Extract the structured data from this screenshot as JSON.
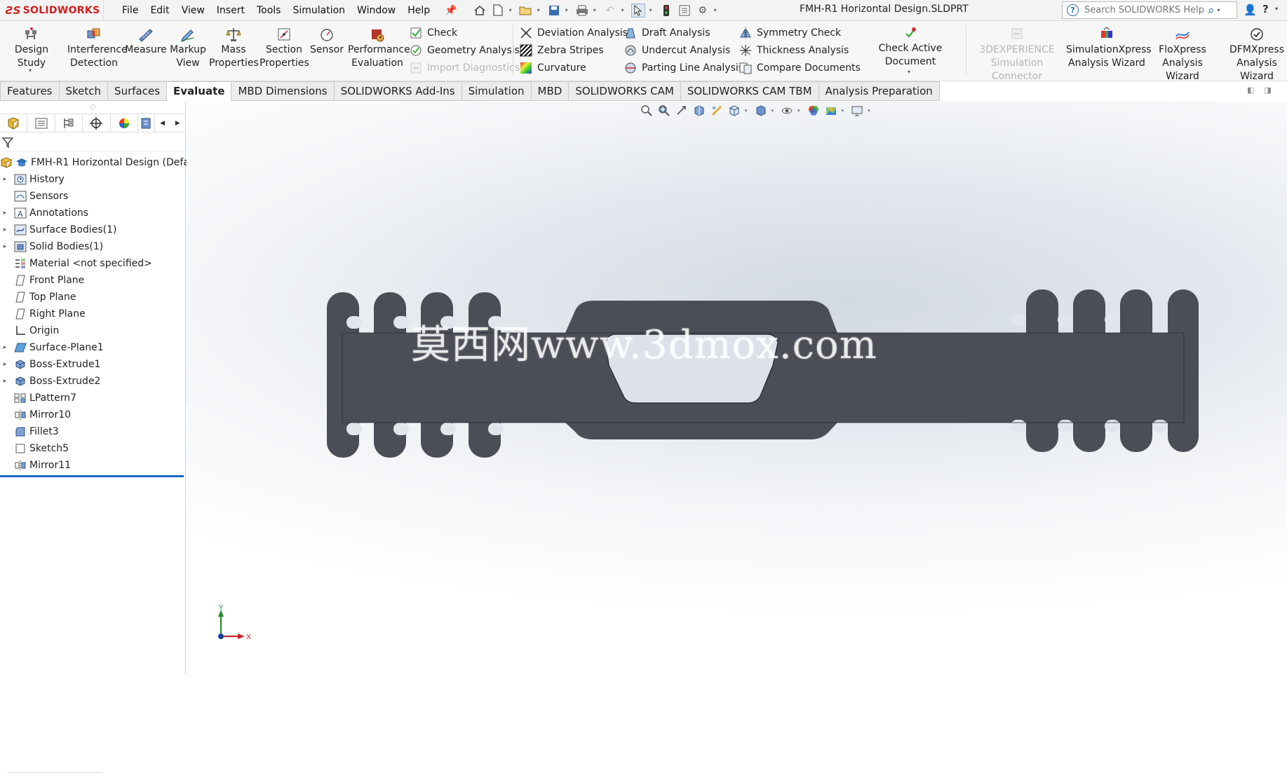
{
  "app": {
    "logo_ds": "ƧS",
    "logo_name": "SOLIDWORKS",
    "menus": [
      "File",
      "Edit",
      "View",
      "Insert",
      "Tools",
      "Simulation",
      "Window",
      "Help"
    ],
    "document_title": "FMH-R1 Horizontal Design.SLDPRT",
    "search_placeholder": "Search SOLIDWORKS Help",
    "help_glyph": "?"
  },
  "ribbon": {
    "design_study": "Design Study",
    "interference_1": "Interference",
    "interference_2": "Detection",
    "measure": "Measure",
    "markup_1": "Markup",
    "markup_2": "View",
    "mass_1": "Mass",
    "mass_2": "Properties",
    "section_1": "Section",
    "section_2": "Properties",
    "sensor": "Sensor",
    "performance_1": "Performance",
    "performance_2": "Evaluation",
    "check": "Check",
    "geometry_analysis": "Geometry Analysis",
    "import_diagnostics": "Import Diagnostics",
    "deviation_analysis": "Deviation Analysis",
    "zebra_stripes": "Zebra Stripes",
    "curvature": "Curvature",
    "draft_analysis": "Draft Analysis",
    "undercut_analysis": "Undercut Analysis",
    "parting_line_analysis": "Parting Line Analysis",
    "symmetry_check": "Symmetry Check",
    "thickness_analysis": "Thickness Analysis",
    "compare_documents": "Compare Documents",
    "check_active_document": "Check Active Document",
    "exp_connector_1": "3DEXPERIENCE",
    "exp_connector_2": "Simulation Connector",
    "simxpress_1": "SimulationXpress",
    "simxpress_2": "Analysis Wizard",
    "floxpress_1": "FloXpress",
    "floxpress_2": "Analysis Wizard",
    "dfmxpress_1": "DFMXpress",
    "dfmxpress_2": "Analysis Wizard"
  },
  "tabs": [
    {
      "label": "Features",
      "active": false
    },
    {
      "label": "Sketch",
      "active": false
    },
    {
      "label": "Surfaces",
      "active": false
    },
    {
      "label": "Evaluate",
      "active": true
    },
    {
      "label": "MBD Dimensions",
      "active": false
    },
    {
      "label": "SOLIDWORKS Add-Ins",
      "active": false
    },
    {
      "label": "Simulation",
      "active": false
    },
    {
      "label": "MBD",
      "active": false
    },
    {
      "label": "SOLIDWORKS CAM",
      "active": false
    },
    {
      "label": "SOLIDWORKS CAM TBM",
      "active": false
    },
    {
      "label": "Analysis Preparation",
      "active": false
    }
  ],
  "feature_tree": {
    "root": "FMH-R1 Horizontal Design  (Defa",
    "items": [
      {
        "label": "History",
        "icon": "history-icon",
        "expandable": true
      },
      {
        "label": "Sensors",
        "icon": "sensors-icon",
        "expandable": false
      },
      {
        "label": "Annotations",
        "icon": "annotations-icon",
        "expandable": true
      },
      {
        "label": "Surface Bodies(1)",
        "icon": "surface-bodies-icon",
        "expandable": true
      },
      {
        "label": "Solid Bodies(1)",
        "icon": "solid-bodies-icon",
        "expandable": true
      },
      {
        "label": "Material <not specified>",
        "icon": "material-icon",
        "expandable": false
      },
      {
        "label": "Front Plane",
        "icon": "plane-icon",
        "expandable": false
      },
      {
        "label": "Top Plane",
        "icon": "plane-icon",
        "expandable": false
      },
      {
        "label": "Right Plane",
        "icon": "plane-icon",
        "expandable": false
      },
      {
        "label": "Origin",
        "icon": "origin-icon",
        "expandable": false
      },
      {
        "label": "Surface-Plane1",
        "icon": "surface-plane-icon",
        "expandable": true
      },
      {
        "label": "Boss-Extrude1",
        "icon": "extrude-icon",
        "expandable": true
      },
      {
        "label": "Boss-Extrude2",
        "icon": "extrude-icon",
        "expandable": true
      },
      {
        "label": "LPattern7",
        "icon": "linear-pattern-icon",
        "expandable": false
      },
      {
        "label": "Mirror10",
        "icon": "mirror-icon",
        "expandable": false
      },
      {
        "label": "Fillet3",
        "icon": "fillet-icon",
        "expandable": false
      },
      {
        "label": "Sketch5",
        "icon": "sketch-icon",
        "expandable": false
      },
      {
        "label": "Mirror11",
        "icon": "mirror-icon",
        "expandable": false
      }
    ]
  },
  "viewport": {
    "watermark": "莫西网www.3dmox.com",
    "triad_y": "Y",
    "triad_x": "X"
  },
  "colors": {
    "brand_red": "#d02020",
    "part_fill": "#4b4e57",
    "selection_blue": "#1e67c4"
  }
}
